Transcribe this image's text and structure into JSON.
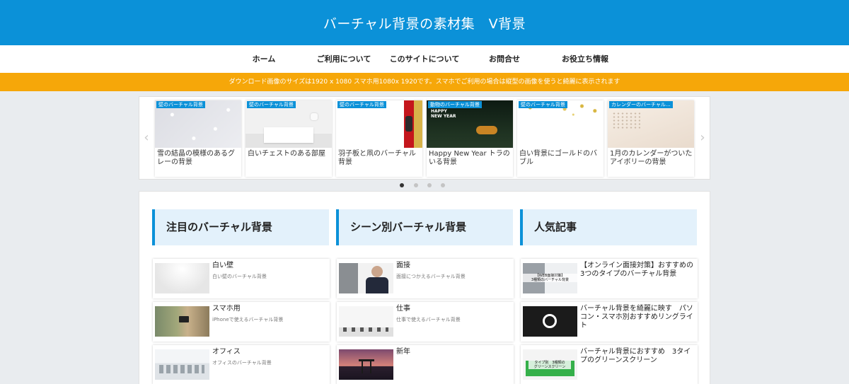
{
  "header": {
    "site_title": "バーチャル背景の素材集　V背景"
  },
  "nav": [
    {
      "label": "ホーム"
    },
    {
      "label": "ご利用について"
    },
    {
      "label": "このサイトについて"
    },
    {
      "label": "お問合せ"
    },
    {
      "label": "お役立ち情報"
    }
  ],
  "notice": {
    "text": "ダウンロード画像のサイズは1920 x 1080 スマホ用1080x 1920です。スマホでご利用の場合は縦型の画像を使うと綺麗に表示されます"
  },
  "carousel": {
    "prev_icon": "‹",
    "next_icon": "›",
    "cards": [
      {
        "badge": "壁のバーチャル背景",
        "title": "雪の結晶の模様のあるグレーの背景"
      },
      {
        "badge": "壁のバーチャル背景",
        "title": "白いチェストのある部屋"
      },
      {
        "badge": "壁のバーチャル背景",
        "title": "羽子板と凧のバーチャル背景"
      },
      {
        "badge": "動物のバーチャル背景",
        "title": "Happy New Year トラのいる背景",
        "thumb_text": "HAPPY\nNEW YEAR"
      },
      {
        "badge": "壁のバーチャル背景",
        "title": "白い背景にゴールドのバブル"
      },
      {
        "badge": "カレンダーのバーチャル...",
        "title": "1月のカレンダーがついたアイボリーの背景"
      }
    ],
    "dots": 4,
    "active_dot": 0
  },
  "featured": {
    "heading": "注目のバーチャル背景",
    "items": [
      {
        "title": "白い壁",
        "desc": "白い壁のバーチャル背景"
      },
      {
        "title": "スマホ用",
        "desc": "iPhoneで使えるバーチャル背景"
      },
      {
        "title": "オフィス",
        "desc": "オフィスのバーチャル背景"
      }
    ]
  },
  "scenes": {
    "heading": "シーン別バーチャル背景",
    "items": [
      {
        "title": "面接",
        "desc": "面接につかえるバーチャル背景"
      },
      {
        "title": "仕事",
        "desc": "仕事で使えるバーチャル背景"
      },
      {
        "title": "新年",
        "desc": ""
      }
    ]
  },
  "popular": {
    "heading": "人気記事",
    "items": [
      {
        "title": "【オンライン面接対策】おすすめの3つのタイプのバーチャル背景",
        "thumb_text": "【WEB面接対策】\n3種類のバーチャル背景"
      },
      {
        "title": "バーチャル背景を綺麗に映す　パソコン・スマホ別おすすめリングライト"
      },
      {
        "title": "バーチャル背景におすすめ　3タイプのグリーンスクリーン",
        "thumb_text": "タイプ別　3種類の\nグリーンスクリーン"
      }
    ]
  },
  "colors": {
    "brand": "#0b91d8",
    "notice": "#f6a709",
    "heading_bg": "#e3f1fb"
  }
}
